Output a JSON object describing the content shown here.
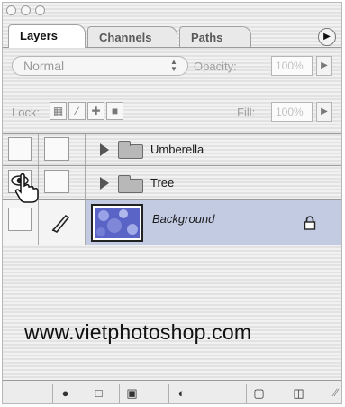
{
  "window": {
    "buttons": [
      "close",
      "minimize",
      "zoom"
    ]
  },
  "tabs": [
    {
      "label": "Layers",
      "active": true
    },
    {
      "label": "Channels",
      "active": false
    },
    {
      "label": "Paths",
      "active": false
    }
  ],
  "blend": {
    "mode": "Normal",
    "opacity_label": "Opacity:",
    "opacity_value": "100%"
  },
  "lock": {
    "label": "Lock:",
    "icons": [
      "lock-transparent-icon",
      "lock-brush-icon",
      "lock-move-icon",
      "lock-all-icon"
    ],
    "fill_label": "Fill:",
    "fill_value": "100%"
  },
  "layers": [
    {
      "name": "Umberella",
      "type": "group",
      "visible": false
    },
    {
      "name": "Tree",
      "type": "group",
      "visible": true
    },
    {
      "name": "Background",
      "type": "image",
      "visible": true,
      "locked": true,
      "selected": true
    }
  ],
  "watermark": "www.vietphotoshop.com",
  "toolbar": {
    "icons": [
      "layer-style-icon",
      "layer-mask-icon",
      "new-group-icon",
      "adjustment-layer-icon",
      "new-layer-icon",
      "trash-icon"
    ]
  },
  "colors": {
    "selected_row": "#c3cbe3",
    "panel_stripe_light": "#f1f1f1",
    "panel_stripe_dark": "#e2e2e2"
  }
}
